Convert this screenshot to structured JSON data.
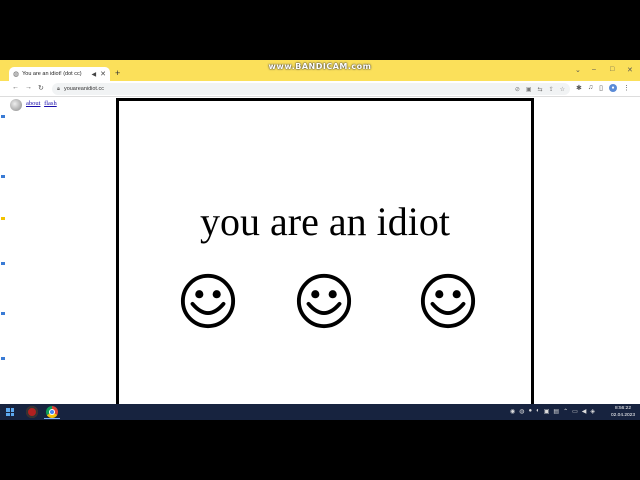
{
  "watermark": "www.BANDICAM.com",
  "browser": {
    "tab_title": "You are an idiot! (dot cc)",
    "url": "youareanidiot.cc"
  },
  "page": {
    "links": [
      "about",
      "flash"
    ],
    "headline": "you are an idiot"
  },
  "taskbar": {
    "time": "8:56:22",
    "date": "02.04.2023"
  }
}
